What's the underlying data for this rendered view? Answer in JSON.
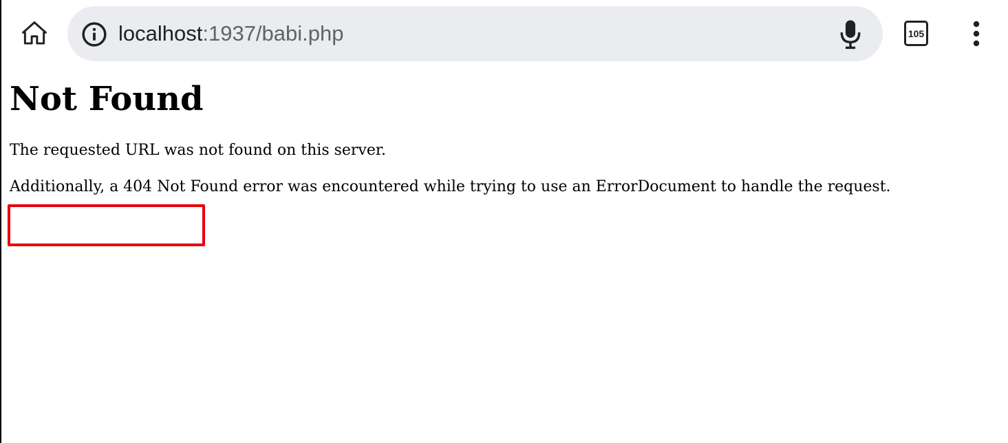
{
  "browser": {
    "home_icon": "home-icon",
    "url": {
      "host": "localhost",
      "path": ":1937/babi.php"
    },
    "info_icon": "info-icon",
    "mic_icon": "microphone-icon",
    "tab_count": "105",
    "menu_icon": "more-vertical-icon"
  },
  "page": {
    "heading": "Not Found",
    "message": "The requested URL was not found on this server.",
    "detail": "Additionally, a 404 Not Found error was encountered while trying to use an ErrorDocument to handle the request."
  },
  "colors": {
    "omnibox_bg": "#ebecf0",
    "highlight": "#e8000b"
  }
}
